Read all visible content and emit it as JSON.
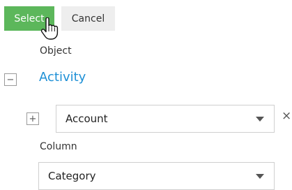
{
  "toolbar": {
    "select_label": "Select",
    "cancel_label": "Cancel"
  },
  "object_section": {
    "label": "Object",
    "collapse_symbol": "−",
    "group_title": "Activity",
    "expand_symbol": "+",
    "selected_object": "Account",
    "remove_symbol": "×"
  },
  "column_section": {
    "label": "Column",
    "selected_column": "Category"
  },
  "icons": {
    "cursor": "hand-pointer-icon",
    "dropdown": "chevron-down-icon",
    "remove": "close-icon"
  },
  "colors": {
    "primary_button": "#5cb75b",
    "secondary_button": "#eeeeee",
    "link_blue": "#1e90d6"
  }
}
